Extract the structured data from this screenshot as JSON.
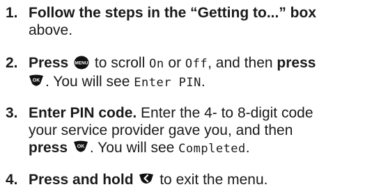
{
  "steps": [
    {
      "number": "1.",
      "bold_text": "Follow the steps in the “Getting to...” box",
      "line2": "above."
    },
    {
      "number": "2.",
      "press1": "Press",
      "menu_icon_label": "MENU",
      "text1": " to scroll ",
      "on": "On",
      "or": " or ",
      "off": "Off",
      "text2": ", and then ",
      "press2": "press",
      "ok_icon_label": "OK",
      "text3": ". You will see ",
      "screen_text": "Enter PIN",
      "end": "."
    },
    {
      "number": "3.",
      "bold_title": "Enter PIN code.",
      "line1_rest": " Enter the 4- to 8-digit code",
      "line2": "your service provider gave you, and then",
      "press": "press",
      "ok_icon_label": "OK",
      "text": ". You will see ",
      "screen_text": "Completed",
      "end": "."
    },
    {
      "number": "4.",
      "bold_text": "Press and hold",
      "text": " to exit the menu."
    }
  ],
  "colors": {
    "text": "#1a1a1a",
    "icon_fill": "#111111",
    "icon_text": "#ffffff"
  }
}
